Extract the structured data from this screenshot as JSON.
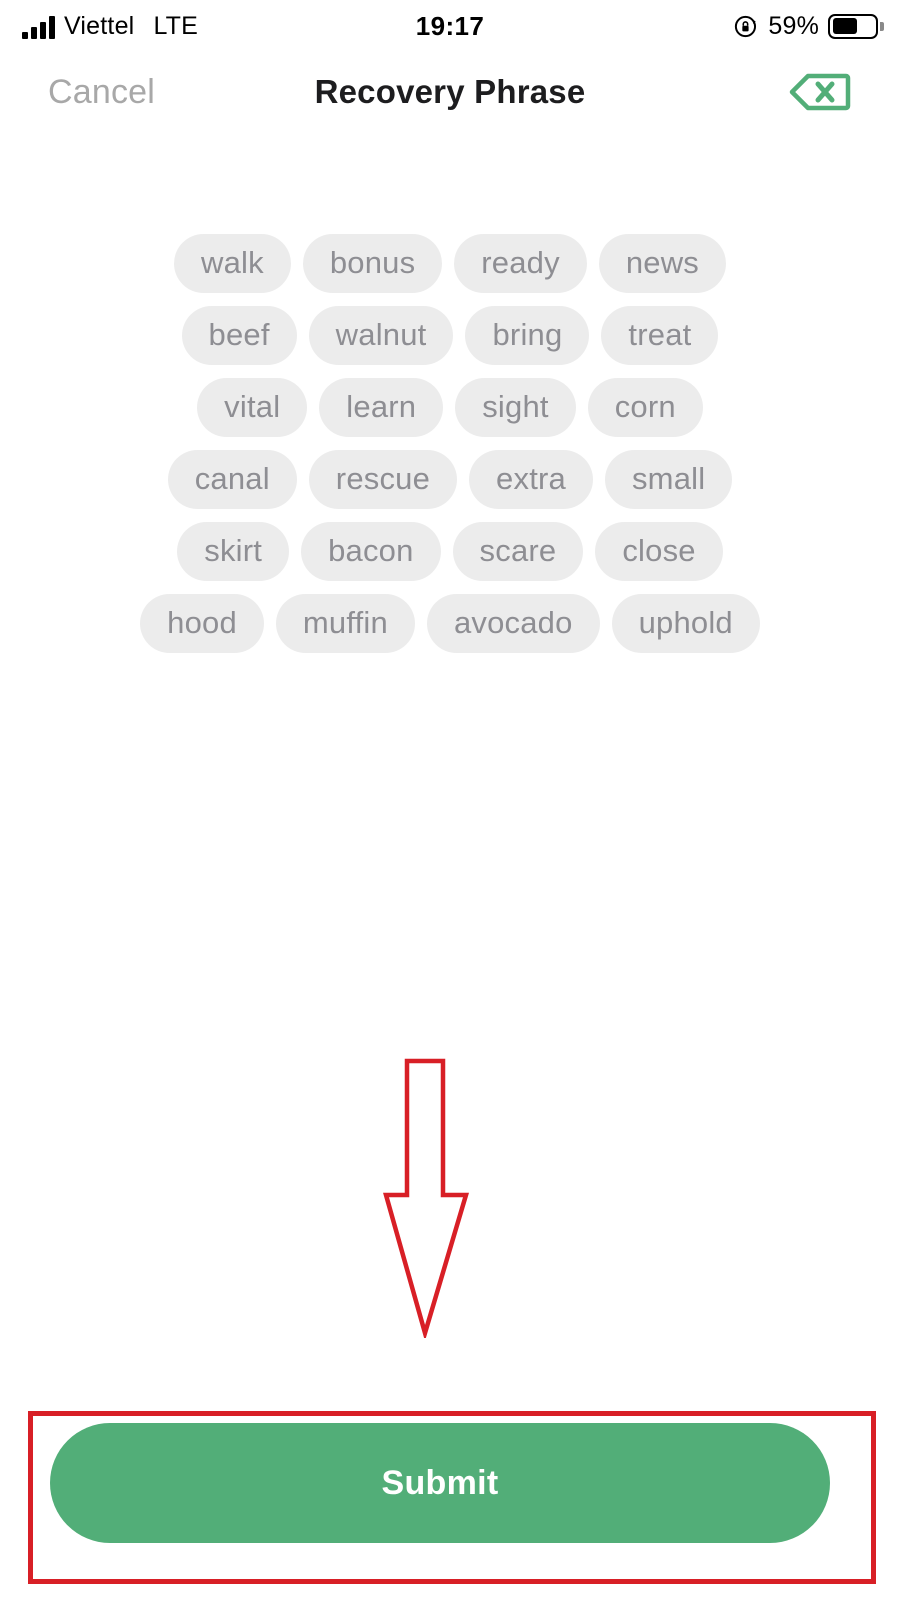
{
  "status_bar": {
    "carrier": "Viettel",
    "network_type": "LTE",
    "time": "19:17",
    "battery_percent": "59%",
    "signal_bars_filled": 4,
    "battery_level": 0.59,
    "rotation_lock_icon": "rotation-lock-icon"
  },
  "header": {
    "cancel_label": "Cancel",
    "title": "Recovery Phrase",
    "backspace_icon": "backspace-delete-icon",
    "accent_color": "#52ae78",
    "cancel_color": "#a8a8a8",
    "title_color": "#1d1d1f"
  },
  "word_grid": {
    "chip_background": "#ececec",
    "chip_text_color": "#8e8e93",
    "words": [
      "walk",
      "bonus",
      "ready",
      "news",
      "beef",
      "walnut",
      "bring",
      "treat",
      "vital",
      "learn",
      "sight",
      "corn",
      "canal",
      "rescue",
      "extra",
      "small",
      "skirt",
      "bacon",
      "scare",
      "close",
      "hood",
      "muffin",
      "avocado",
      "uphold"
    ]
  },
  "annotations": {
    "arrow_icon": "down-arrow-annotation-icon",
    "arrow_color": "#d81f26",
    "highlight_box_color": "#d81f26"
  },
  "footer": {
    "submit_label": "Submit",
    "submit_color": "#52ae78",
    "submit_text_color": "#ffffff"
  }
}
